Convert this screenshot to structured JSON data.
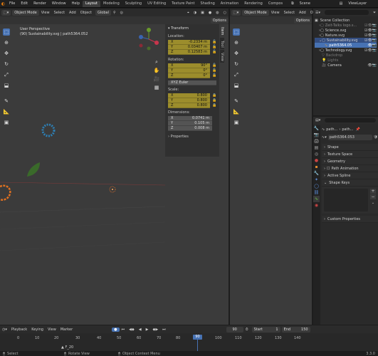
{
  "menu": [
    "File",
    "Edit",
    "Render",
    "Window",
    "Help"
  ],
  "workspaces": [
    "Layout",
    "Modeling",
    "Sculpting",
    "UV Editing",
    "Texture Paint",
    "Shading",
    "Animation",
    "Rendering",
    "Compos"
  ],
  "scene_label": "Scene",
  "viewlayer_label": "ViewLayer",
  "left_header": {
    "mode": "Object Mode",
    "items": [
      "View",
      "Select",
      "Add",
      "Object"
    ],
    "orientation": "Global",
    "options": "Options"
  },
  "right_header": {
    "mode": "Object Mode",
    "items": [
      "View",
      "Select",
      "Add",
      "Object"
    ],
    "options": "Options"
  },
  "viewport_info": {
    "line1": "User Perspective",
    "line2": "(90) Sustainability.svg | path5364.052"
  },
  "npanel": {
    "section": "Transform",
    "location_label": "Location:",
    "location": [
      {
        "axis": "X",
        "value": "-0.2334 m"
      },
      {
        "axis": "Y",
        "value": "0.03407 m"
      },
      {
        "axis": "Z",
        "value": "0.12583 m"
      }
    ],
    "rotation_label": "Rotation:",
    "rotation": [
      {
        "axis": "X",
        "value": "90°"
      },
      {
        "axis": "Y",
        "value": "0°"
      },
      {
        "axis": "Z",
        "value": "0°"
      }
    ],
    "rotation_mode": "XYZ Euler",
    "scale_label": "Scale:",
    "scale": [
      {
        "axis": "X",
        "value": "0.800"
      },
      {
        "axis": "Y",
        "value": "0.800"
      },
      {
        "axis": "Z",
        "value": "0.800"
      }
    ],
    "dimensions_label": "Dimensions:",
    "dimensions": [
      {
        "axis": "X",
        "value": "0.0741 m"
      },
      {
        "axis": "Y",
        "value": "0.105 m"
      },
      {
        "axis": "Z",
        "value": "0.008 m"
      }
    ],
    "properties": "Properties",
    "tabs": [
      "Item",
      "Tool",
      "View"
    ]
  },
  "outliner": {
    "root": "Scene Collection",
    "items": [
      "Zeit-Talks logo.s...",
      "Science.svg",
      "Nature.svg",
      "Sustainability.svg",
      "path5364.05",
      "Technology.svg",
      "Backdrop",
      "Lights",
      "Camera"
    ]
  },
  "properties_panel": {
    "breadcrumb": "path...",
    "breadcrumb2": "path...",
    "data_name": "path5364.053",
    "sections": [
      "Shape",
      "Texture Space",
      "Geometry",
      "Path Animation",
      "Active Spline",
      "Shape Keys",
      "Custom Properties"
    ]
  },
  "timeline": {
    "menus": [
      "Playback",
      "Keying",
      "View",
      "Marker"
    ],
    "current_frame": "90",
    "start_label": "Start",
    "start": "1",
    "end_label": "End",
    "end": "150",
    "ticks": [
      "0",
      "10",
      "20",
      "30",
      "40",
      "50",
      "60",
      "70",
      "80",
      "90",
      "100",
      "110",
      "120",
      "130",
      "140"
    ],
    "cursor_frame": "90",
    "marker": "F_20"
  },
  "statusbar": {
    "left": "Select",
    "mid1": "Rotate View",
    "mid2": "Object Context Menu",
    "version": "3.3.0"
  },
  "colors": {
    "accent": "#4772b3",
    "field_yellow": "#9c8d2c",
    "bg": "#3b3b3b"
  }
}
